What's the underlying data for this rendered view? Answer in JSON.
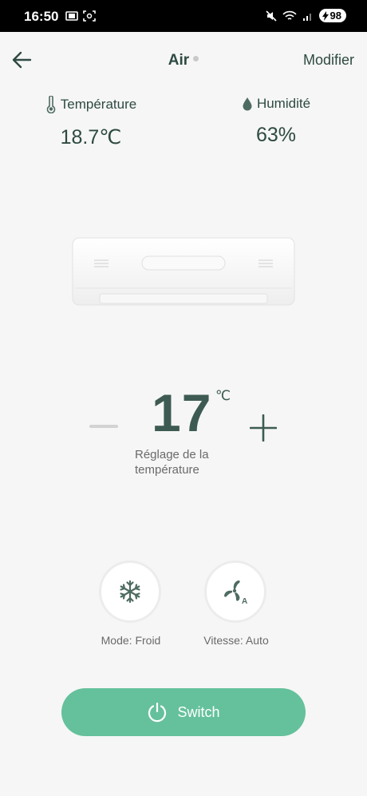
{
  "status_bar": {
    "time": "16:50",
    "battery": "98"
  },
  "header": {
    "title": "Air",
    "modify_label": "Modifier"
  },
  "sensors": {
    "temperature": {
      "label": "Température",
      "value": "18.7℃",
      "icon": "thermometer-icon"
    },
    "humidity": {
      "label": "Humidité",
      "value": "63%",
      "icon": "water-drop-icon"
    }
  },
  "setpoint": {
    "value": "17",
    "unit": "℃",
    "caption": "Réglage de la température"
  },
  "controls": {
    "mode_label": "Mode: Froid",
    "speed_label": "Vitesse: Auto"
  },
  "switch": {
    "label": "Switch"
  },
  "colors": {
    "accent": "#64c19c",
    "text": "#2e4a42",
    "background": "#f6f6f6"
  }
}
